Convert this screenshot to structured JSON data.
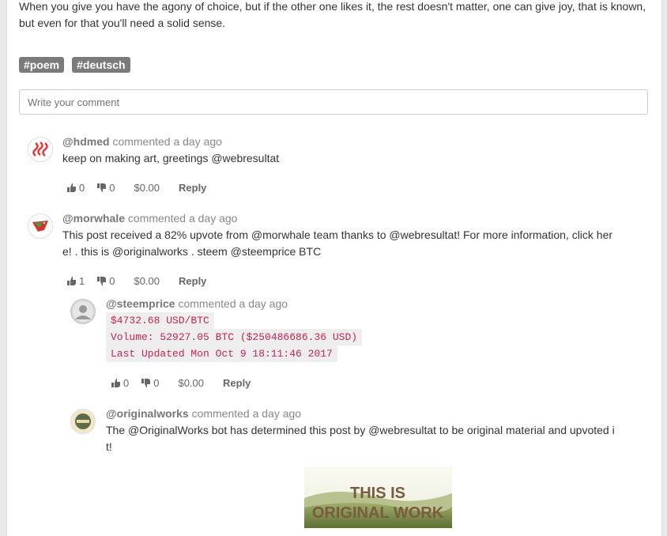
{
  "intro_text": "When you give you have the agony of choice, but if the other one likes it, the rest doesn't matter, one can give joy, that is known, but even for that you'll need a solid sense.",
  "tags": [
    "#poem",
    "#deutsch"
  ],
  "comment_input": {
    "placeholder": "Write your comment"
  },
  "comments": [
    {
      "author": "@hdmed",
      "meta": "commented a day ago",
      "body": "keep on making art, greetings @webresultat",
      "upvotes": "0",
      "downvotes": "0",
      "payout": "$0.00",
      "reply": "Reply"
    },
    {
      "author": "@morwhale",
      "meta": "commented a day ago",
      "body_line1": "This post received a 82% upvote from @morwhale team thanks to @webresultat! For more information, click her",
      "body_line2": "e! . this is @originalworks . steem @steemprice BTC",
      "upvotes": "1",
      "downvotes": "0",
      "payout": "$0.00",
      "reply": "Reply"
    },
    {
      "author": "@steemprice",
      "meta": "commented a day ago",
      "code_lines": [
        "$4732.68 USD/BTC",
        "Volume: 52927.05 BTC ($250486686.36 USD)",
        "Last Updated Mon Oct 9 18:11:46 2017"
      ],
      "upvotes": "0",
      "downvotes": "0",
      "payout": "$0.00",
      "reply": "Reply"
    },
    {
      "author": "@originalworks",
      "meta": "commented a day ago",
      "body_line1": "The @OriginalWorks bot has determined this post by @webresultat to be original material and upvoted i",
      "body_line2": "t!"
    }
  ],
  "banner": {
    "line1": "THIS IS",
    "line2": "ORIGINAL WORK"
  },
  "colors": {
    "tag_bg": "#7b7b7b",
    "code_text": "#c7254e",
    "code_bg": "#eeeeee"
  }
}
